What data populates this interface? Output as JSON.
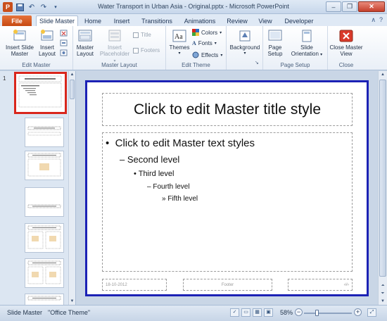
{
  "window": {
    "title": "Water Transport in Urban Asia - Original.pptx - Microsoft PowerPoint",
    "app_icon": "P"
  },
  "tabs": [
    {
      "label": "File"
    },
    {
      "label": "Slide Master"
    },
    {
      "label": "Home"
    },
    {
      "label": "Insert"
    },
    {
      "label": "Transitions"
    },
    {
      "label": "Animations"
    },
    {
      "label": "Review"
    },
    {
      "label": "View"
    },
    {
      "label": "Developer"
    }
  ],
  "ribbon": {
    "edit_master": {
      "label": "Edit Master",
      "insert_slide_master": "Insert Slide Master",
      "insert_layout": "Insert Layout"
    },
    "master_layout": {
      "label": "Master Layout",
      "master_layout": "Master Layout",
      "insert_placeholder": "Insert Placeholder",
      "title": "Title",
      "footers": "Footers"
    },
    "edit_theme": {
      "label": "Edit Theme",
      "themes": "Themes",
      "colors": "Colors",
      "fonts": "Fonts",
      "effects": "Effects"
    },
    "background": {
      "label": "Background"
    },
    "page_setup": {
      "label": "Page Setup",
      "page_setup": "Page Setup",
      "slide_orientation": "Slide Orientation"
    },
    "close": {
      "label": "Close",
      "close_master_view": "Close Master View"
    }
  },
  "thumbnails": {
    "first_number": "1"
  },
  "slide": {
    "title": "Click to edit Master title style",
    "levels": [
      "Click to edit Master text styles",
      "Second level",
      "Third level",
      "Fourth level",
      "Fifth level"
    ],
    "bullets": [
      "•",
      "–",
      "•",
      "–",
      "»"
    ],
    "footer_date": "18-10-2012",
    "footer_text": "Footer",
    "footer_num": "‹#›"
  },
  "statusbar": {
    "view": "Slide Master",
    "theme": "\"Office Theme\"",
    "zoom": "58%"
  },
  "colors": {
    "selected_thumb": "#d9261c",
    "slide_border": "#1c22b5",
    "file_tab": "#c74a12"
  }
}
